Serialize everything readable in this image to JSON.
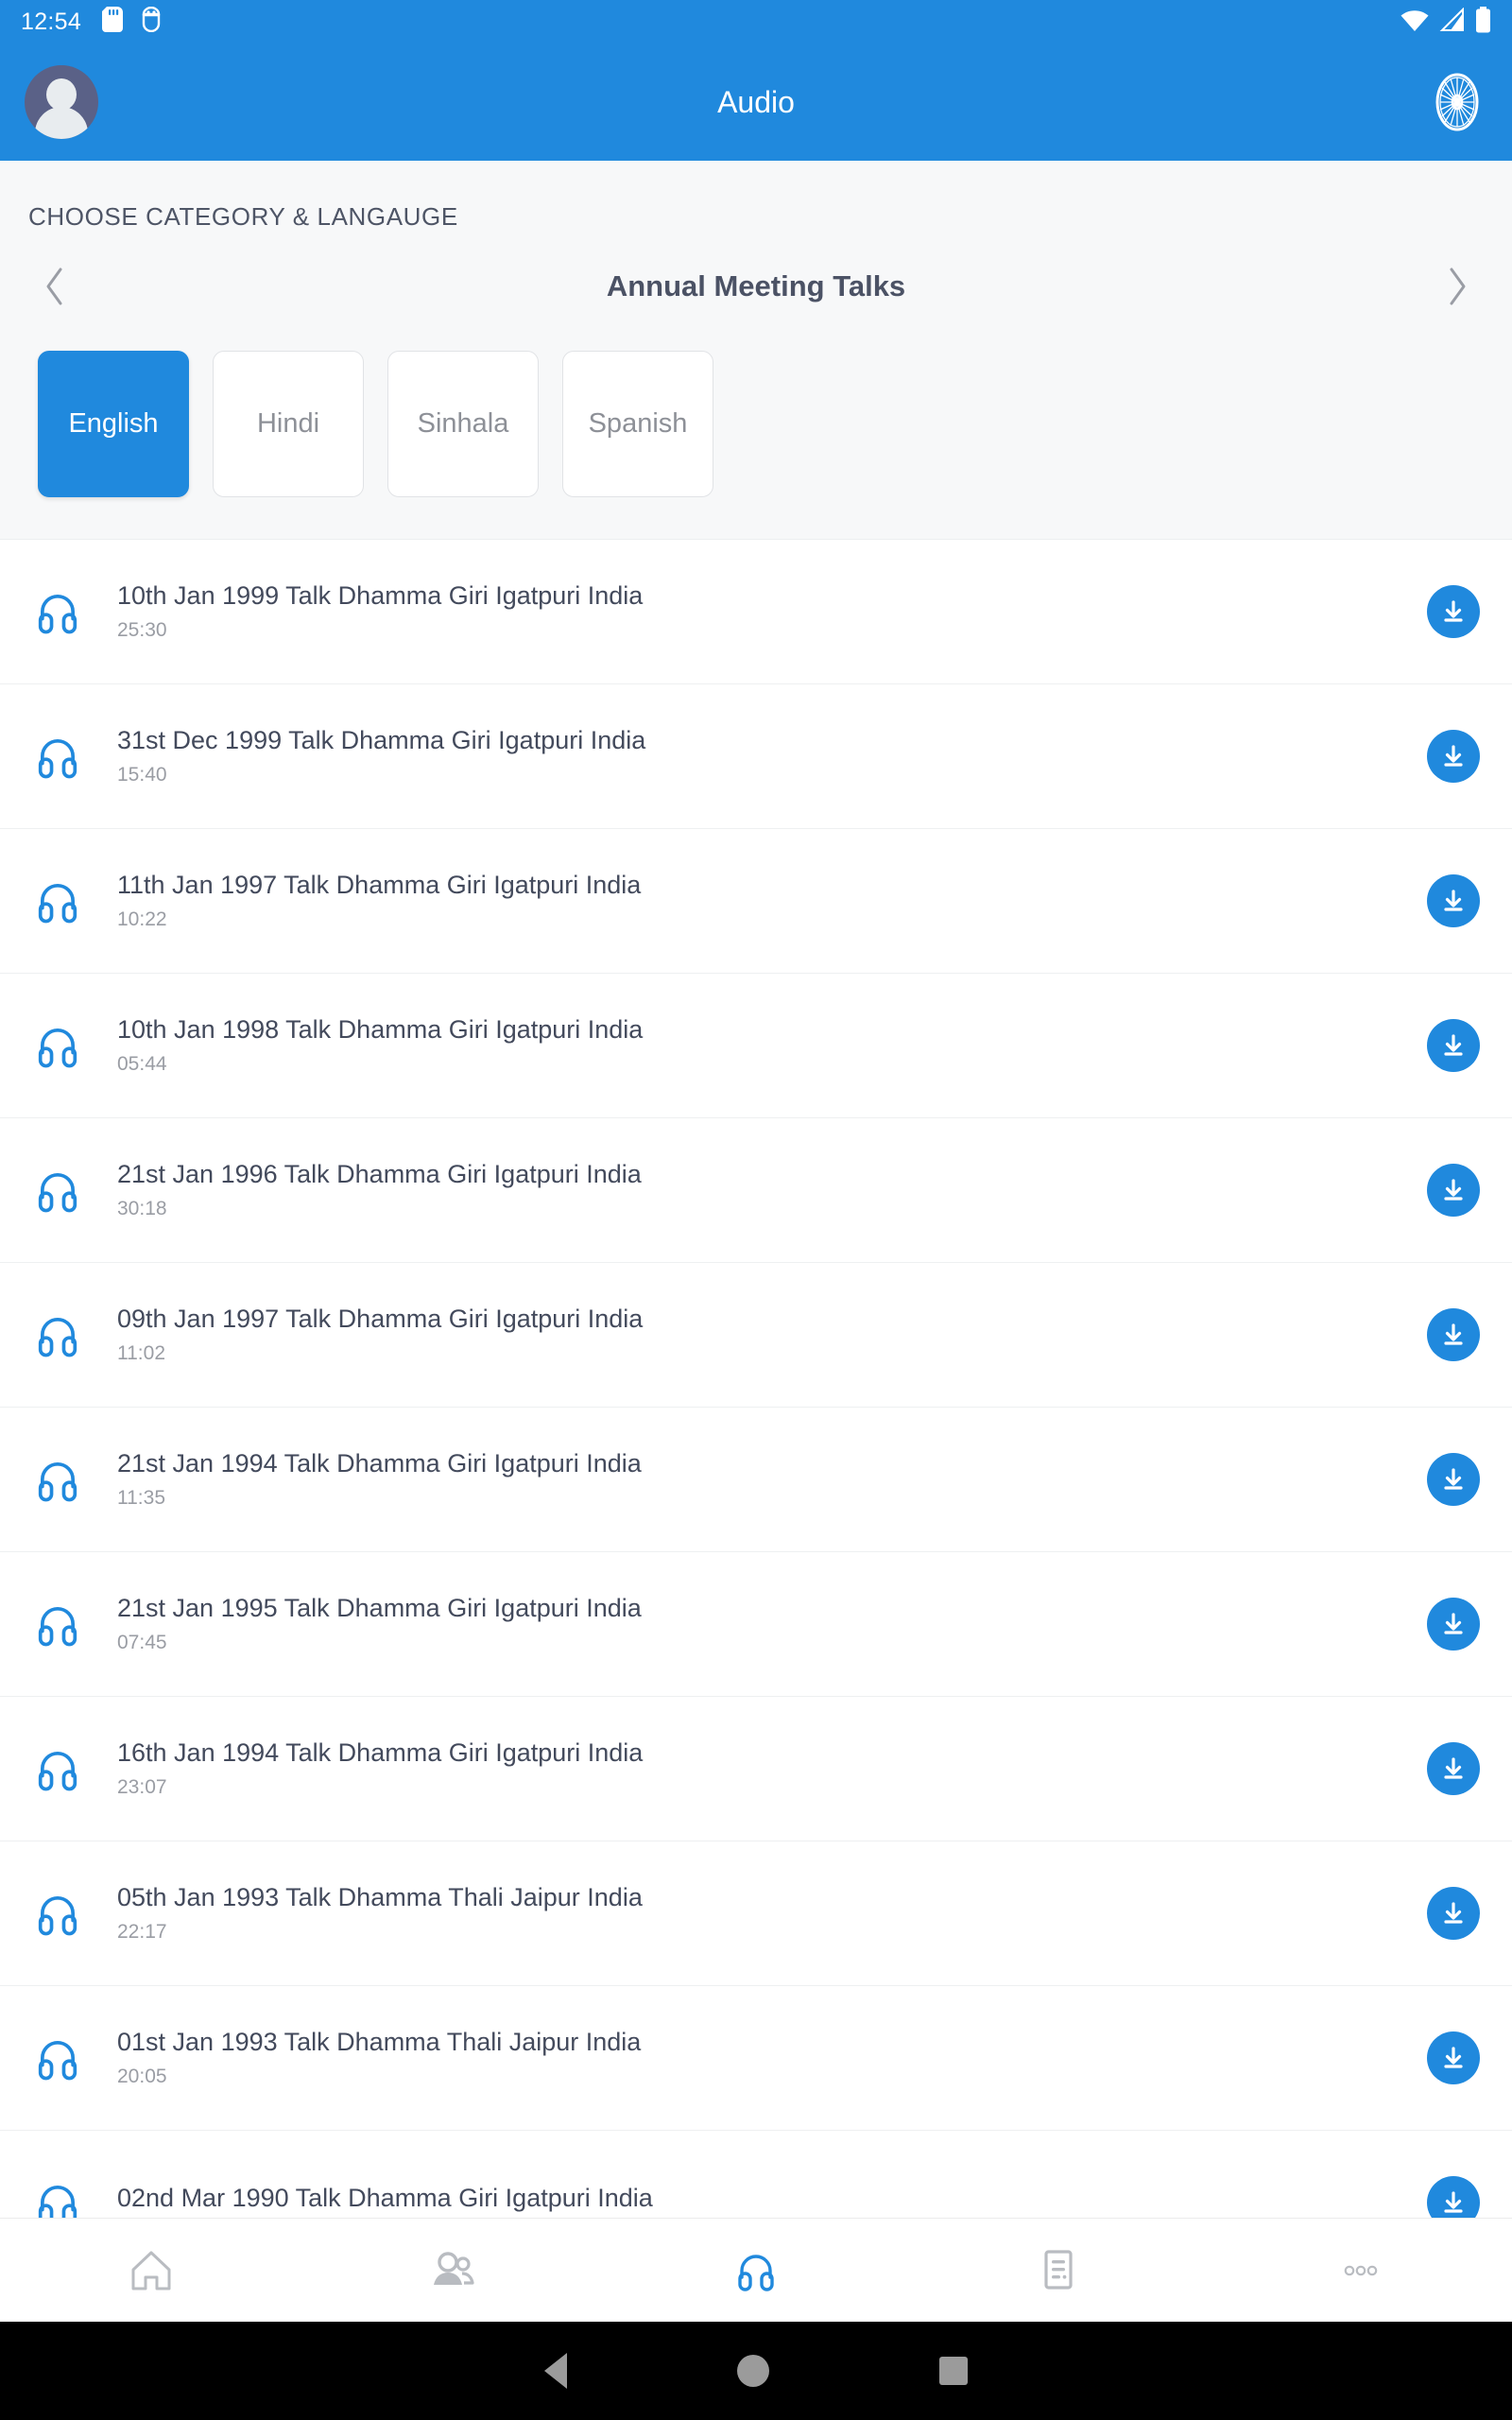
{
  "statusbar": {
    "time": "12:54",
    "icons": [
      "sd-card-icon",
      "android-debug-icon",
      "wifi-icon",
      "cellular-signal-icon",
      "battery-icon"
    ]
  },
  "appbar": {
    "title": "Audio",
    "avatar_name": "profile-avatar",
    "logo_name": "dhamma-wheel-icon",
    "bg_color": "#2089dd"
  },
  "chooser": {
    "label": "CHOOSE CATEGORY & LANGAUGE",
    "prev_label": "‹",
    "next_label": "›",
    "category": "Annual Meeting Talks",
    "languages": [
      {
        "label": "English",
        "selected": true
      },
      {
        "label": "Hindi",
        "selected": false
      },
      {
        "label": "Sinhala",
        "selected": false
      },
      {
        "label": "Spanish",
        "selected": false
      }
    ]
  },
  "list": {
    "items": [
      {
        "title": "10th Jan 1999 Talk Dhamma Giri Igatpuri India",
        "duration": "25:30"
      },
      {
        "title": "31st Dec 1999 Talk Dhamma Giri Igatpuri India",
        "duration": "15:40"
      },
      {
        "title": "11th Jan 1997 Talk Dhamma Giri Igatpuri India",
        "duration": "10:22"
      },
      {
        "title": "10th Jan 1998 Talk Dhamma Giri Igatpuri India",
        "duration": "05:44"
      },
      {
        "title": "21st Jan 1996 Talk Dhamma Giri Igatpuri India",
        "duration": "30:18"
      },
      {
        "title": "09th Jan 1997 Talk Dhamma Giri Igatpuri India",
        "duration": "11:02"
      },
      {
        "title": "21st Jan 1994 Talk Dhamma Giri Igatpuri India",
        "duration": "11:35"
      },
      {
        "title": "21st Jan 1995 Talk Dhamma Giri Igatpuri India",
        "duration": "07:45"
      },
      {
        "title": "16th Jan 1994 Talk Dhamma Giri Igatpuri India",
        "duration": "23:07"
      },
      {
        "title": "05th Jan 1993 Talk Dhamma Thali Jaipur India",
        "duration": "22:17"
      },
      {
        "title": "01st Jan 1993 Talk Dhamma Thali Jaipur India",
        "duration": "20:05"
      },
      {
        "title": "02nd Mar 1990 Talk Dhamma Giri Igatpuri India",
        "duration": ""
      }
    ]
  },
  "bottomnav": {
    "items": [
      {
        "name": "home-icon",
        "active": false
      },
      {
        "name": "people-icon",
        "active": false
      },
      {
        "name": "headphones-icon",
        "active": true
      },
      {
        "name": "document-icon",
        "active": false
      },
      {
        "name": "more-icon",
        "active": false
      }
    ],
    "active_color": "#2089dd",
    "inactive_color": "#b9bcc1"
  },
  "androidnav": {
    "items": [
      "back-button",
      "home-button",
      "recents-button"
    ]
  }
}
